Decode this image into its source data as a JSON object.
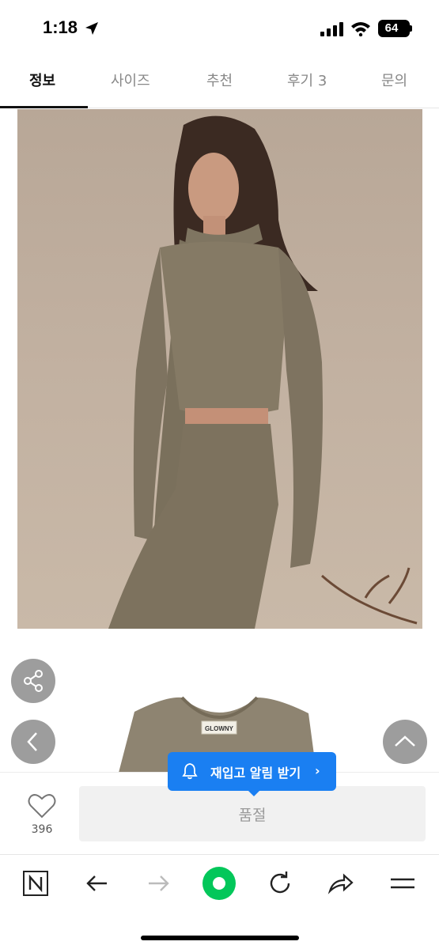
{
  "status_bar": {
    "time": "1:18",
    "battery": "64"
  },
  "tabs": [
    {
      "label": "정보",
      "active": true
    },
    {
      "label": "사이즈",
      "active": false
    },
    {
      "label": "추천",
      "active": false
    },
    {
      "label": "후기 3",
      "active": false
    },
    {
      "label": "문의",
      "active": false
    }
  ],
  "product": {
    "tag_label": "GLOWNY"
  },
  "restock": {
    "label": "재입고 알림 받기",
    "chevron": "›"
  },
  "purchase": {
    "wish_count": "396",
    "soldout_label": "품절"
  },
  "browser": {
    "icons": [
      "naver-n-icon",
      "back-arrow-icon",
      "forward-arrow-icon",
      "green-dot-icon",
      "reload-icon",
      "share-arrow-icon",
      "menu-icon"
    ]
  },
  "colors": {
    "accent_blue": "#1a7ff2",
    "browser_green": "#03c75a"
  }
}
